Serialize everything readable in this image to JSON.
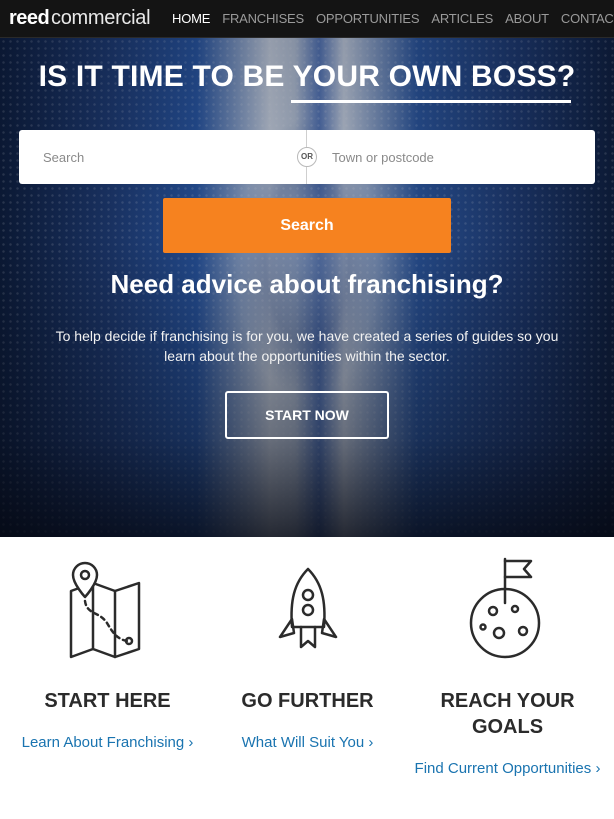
{
  "nav": {
    "logo_bold": "reed",
    "logo_light": "commercial",
    "links": [
      "HOME",
      "FRANCHISES",
      "OPPORTUNITIES",
      "ARTICLES",
      "ABOUT",
      "CONTACT"
    ]
  },
  "hero": {
    "headline": "IS IT TIME TO BE YOUR OWN BOSS?",
    "search_placeholder": "Search",
    "or_label": "OR",
    "location_placeholder": "Town or postcode",
    "search_button": "Search",
    "advice_title": "Need advice about franchising?",
    "advice_text": "To help decide if franchising is for you, we have created a series of guides so you learn about the opportunities within the sector.",
    "start_button": "START NOW"
  },
  "features": [
    {
      "title": "START HERE",
      "link": "Learn About Franchising ›",
      "icon": "map-pin-icon"
    },
    {
      "title": "GO FURTHER",
      "link": "What Will Suit You ›",
      "icon": "rocket-icon"
    },
    {
      "title": "REACH YOUR GOALS",
      "link": "Find Current Opportunities ›",
      "icon": "moon-flag-icon"
    }
  ],
  "colors": {
    "accent": "#f6821f",
    "link": "#1a74b0",
    "nav_bg": "#141414"
  }
}
